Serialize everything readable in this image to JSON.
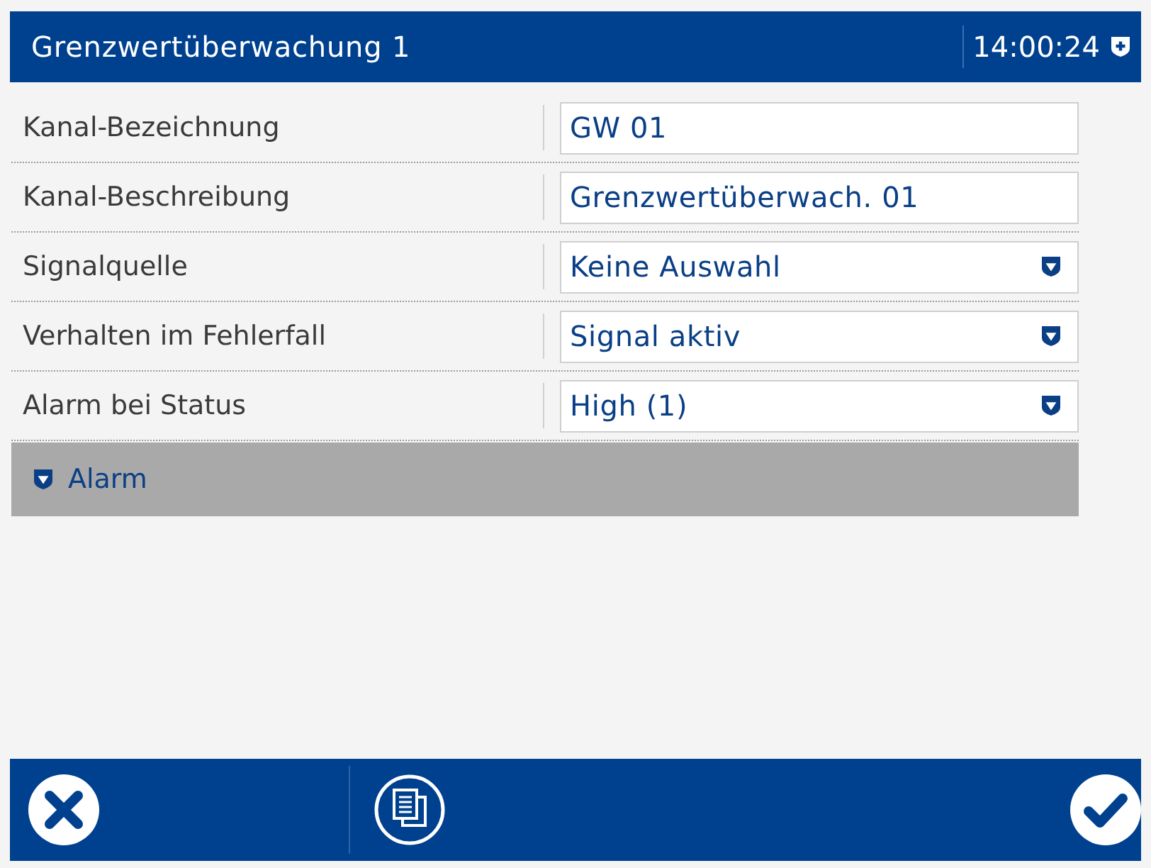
{
  "window": {
    "title": "Grenzwertüberwachung 1",
    "time": "14:00:24"
  },
  "fields": [
    {
      "label": "Kanal-Bezeichnung",
      "kind": "text",
      "value": "GW 01"
    },
    {
      "label": "Kanal-Beschreibung",
      "kind": "text",
      "value": "Grenzwertüberwach. 01"
    },
    {
      "label": "Signalquelle",
      "kind": "select",
      "value": "Keine Auswahl"
    },
    {
      "label": "Verhalten im Fehlerfall",
      "kind": "select",
      "value": "Signal aktiv"
    },
    {
      "label": "Alarm bei Status",
      "kind": "select",
      "value": "High (1)"
    }
  ],
  "sections": [
    {
      "label": "Alarm",
      "expanded": false
    }
  ]
}
